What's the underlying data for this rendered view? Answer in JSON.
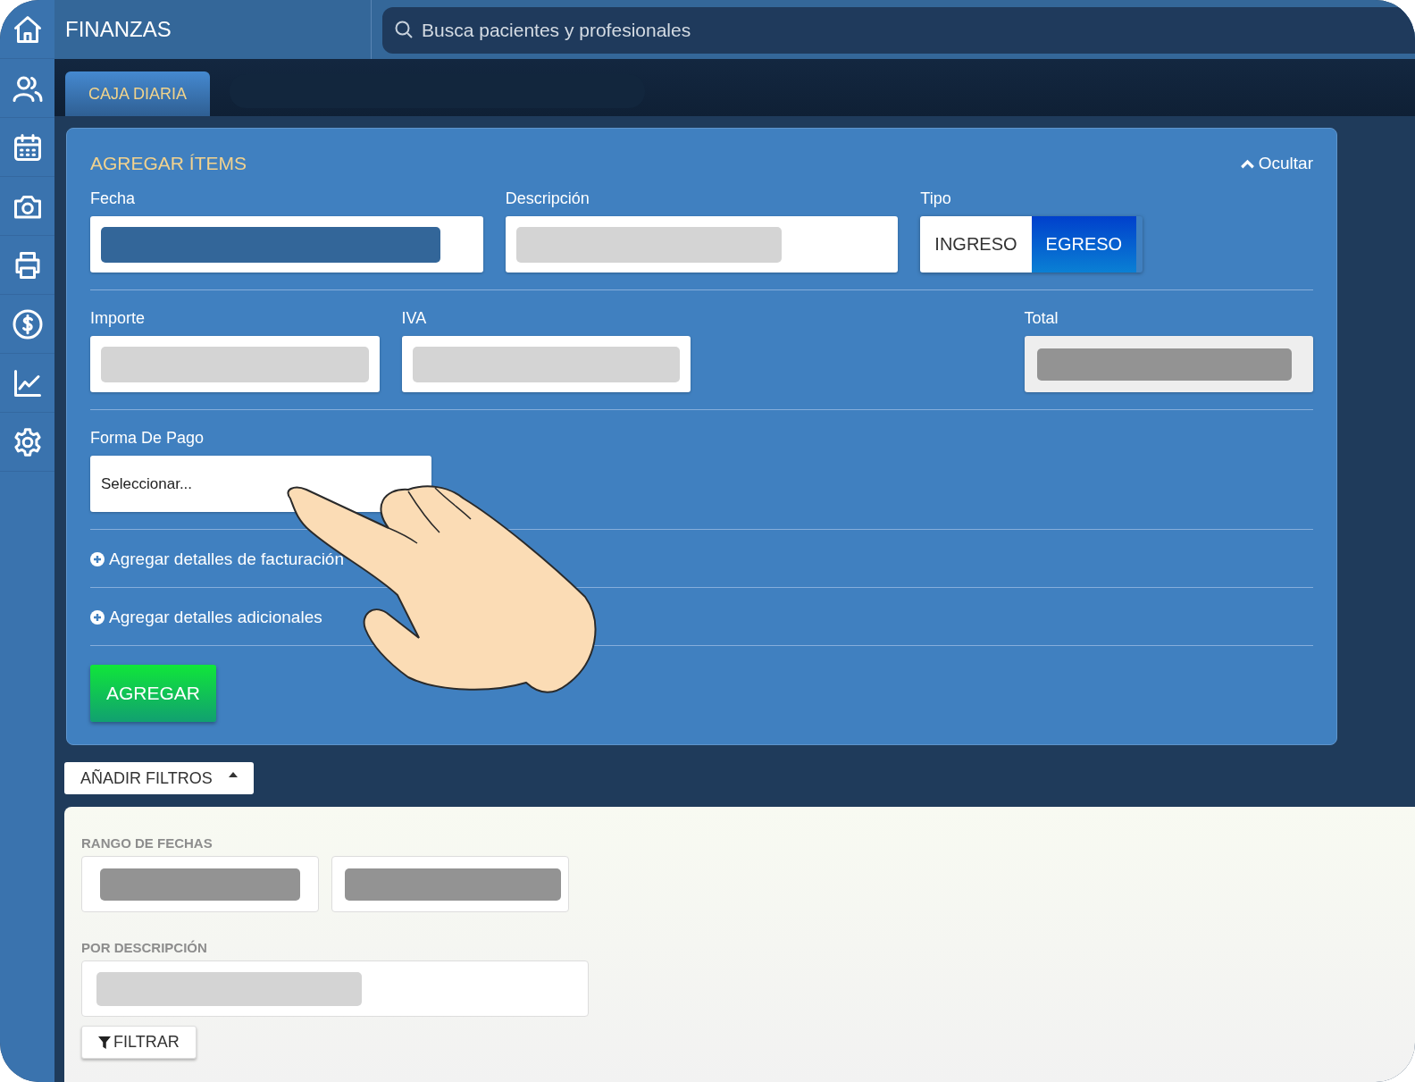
{
  "sidebar": {
    "items": [
      {
        "kind": "home"
      },
      {
        "kind": "users"
      },
      {
        "kind": "calendar"
      },
      {
        "kind": "camera"
      },
      {
        "kind": "printer"
      },
      {
        "kind": "dollar"
      },
      {
        "kind": "chart"
      },
      {
        "kind": "settings"
      }
    ]
  },
  "header": {
    "title": "FINANZAS",
    "search": {
      "placeholder": "Busca pacientes y profesionales"
    }
  },
  "tabs": [
    {
      "label": "CAJA DIARIA",
      "selected": true
    }
  ],
  "form": {
    "title": "AGREGAR ÍTEMS",
    "toggle": "Ocultar",
    "row_1": [
      {
        "label": "Fecha",
        "redacted": true,
        "kind": "date"
      },
      {
        "label": "Descripción",
        "redacted": true,
        "kind": "text"
      }
    ],
    "tipo": {
      "label": "Tipo",
      "options": [
        {
          "label": "INGRESO",
          "selected": false
        },
        {
          "label": "EGRESO",
          "selected": true
        }
      ]
    },
    "row_2": [
      {
        "label": "Importe",
        "redacted": true,
        "kind": "text"
      },
      {
        "label": "IVA",
        "redacted": true,
        "kind": "text"
      },
      {
        "label": "Total",
        "redacted": true,
        "kind": "readonly"
      }
    ],
    "payment": {
      "label": "Forma De Pago",
      "placeholder": "Seleccionar..."
    },
    "links": [
      "Agregar detalles de facturación",
      "Agregar detalles adicionales"
    ],
    "submit": "AGREGAR"
  },
  "filters": {
    "button": "AÑADIR FILTROS",
    "expanded": true,
    "date_range": {
      "label": "RANGO DE FECHAS",
      "fields": [
        {
          "redacted": true
        },
        {
          "redacted": true
        }
      ]
    },
    "description": {
      "label": "POR DESCRIPCIÓN",
      "redacted": true
    },
    "submit": "FILTRAR"
  }
}
